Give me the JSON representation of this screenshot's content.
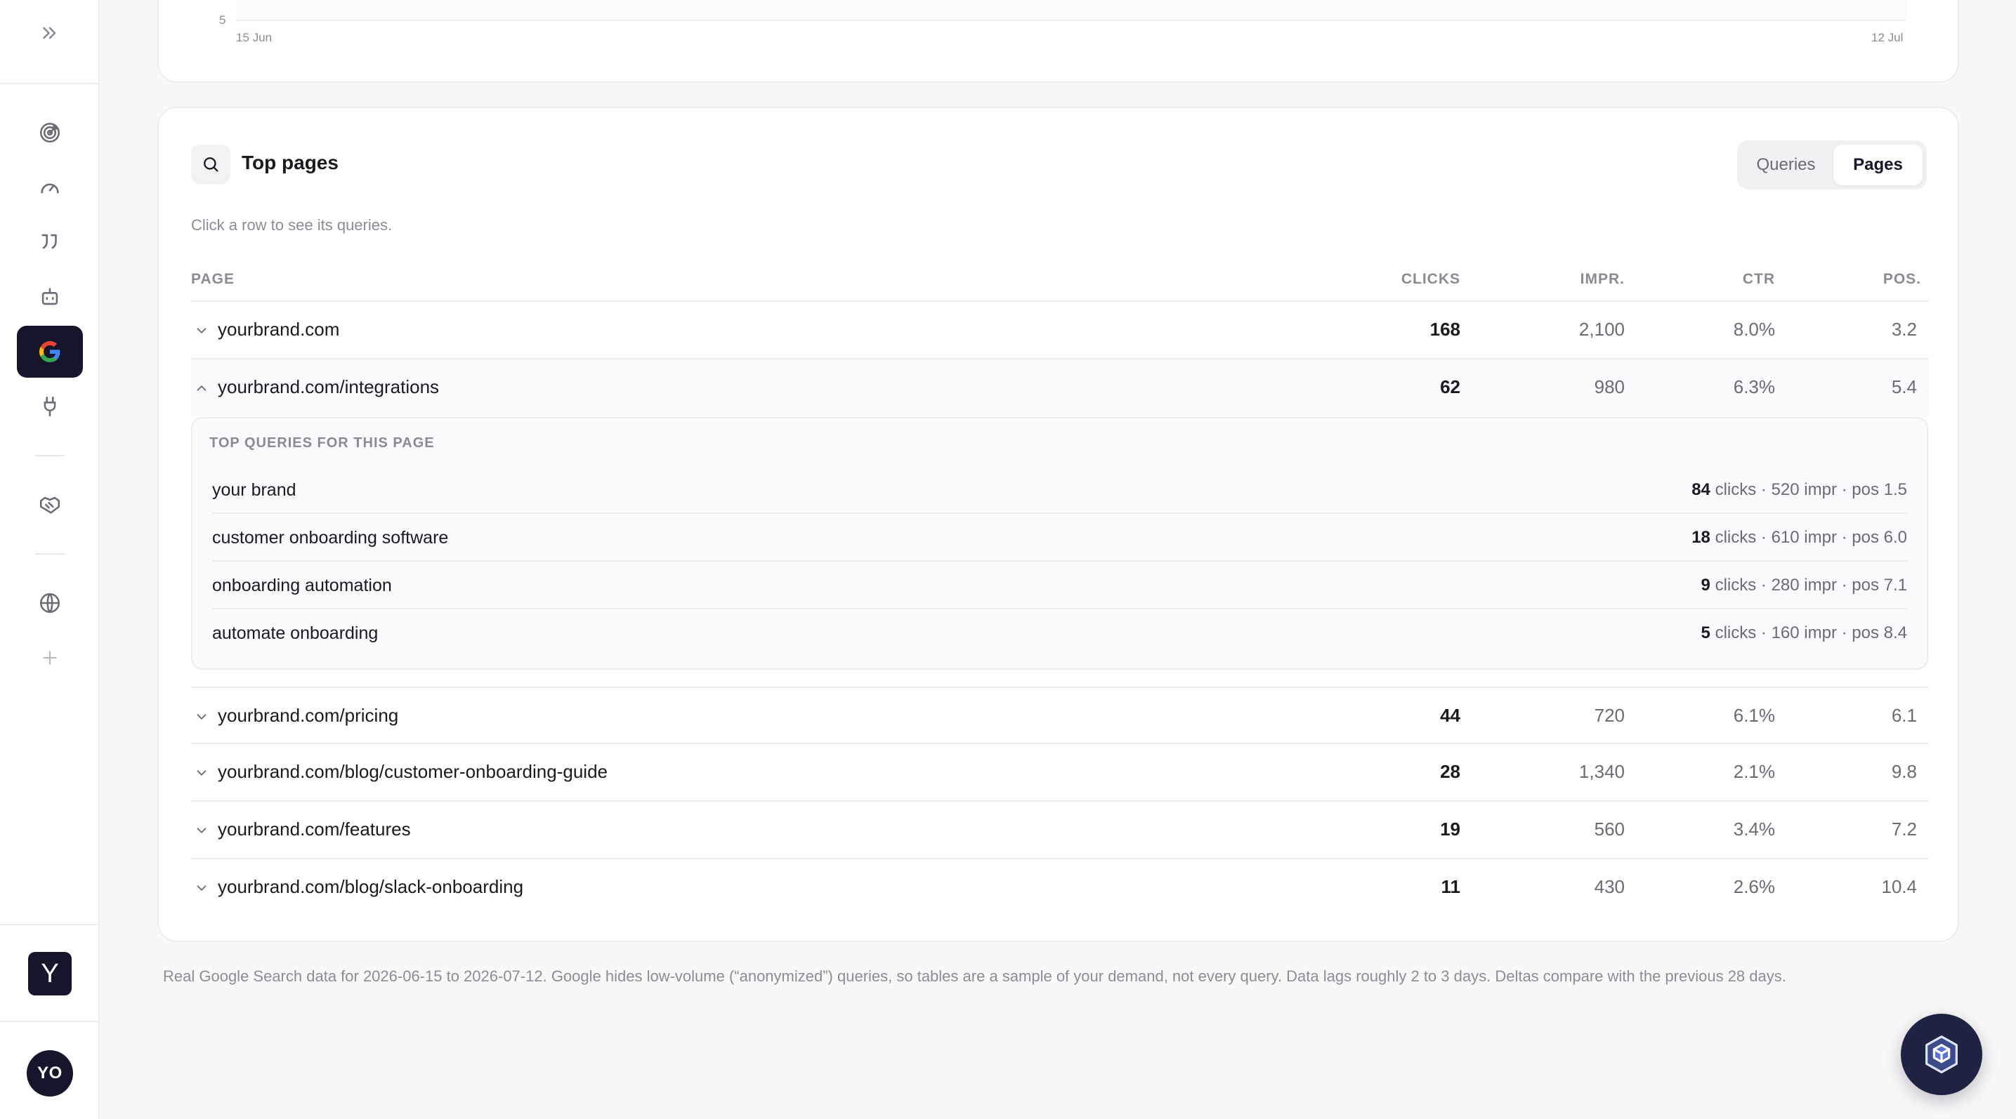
{
  "sidebar": {
    "items": [
      {
        "icon": "chevrons-right-icon"
      },
      {
        "icon": "target-icon"
      },
      {
        "icon": "gauge-icon"
      },
      {
        "icon": "quote-icon"
      },
      {
        "icon": "robot-icon"
      },
      {
        "icon": "google-icon",
        "active": true
      },
      {
        "icon": "plug-icon"
      },
      {
        "icon": "handshake-icon"
      },
      {
        "icon": "globe-icon"
      },
      {
        "icon": "plus-icon"
      }
    ],
    "logo_letter": "Y",
    "avatar_initials": "YO"
  },
  "chart": {
    "y_tick": "5",
    "x_start": "15 Jun",
    "x_end": "12 Jul"
  },
  "top_pages": {
    "title": "Top pages",
    "tabs": [
      "Queries",
      "Pages"
    ],
    "active_tab": "Pages",
    "hint": "Click a row to see its queries.",
    "columns": {
      "page": "PAGE",
      "clicks": "CLICKS",
      "impr": "IMPR.",
      "ctr": "CTR",
      "pos": "POS."
    },
    "rows": [
      {
        "page": "yourbrand.com",
        "clicks": "168",
        "impr": "2,100",
        "ctr": "8.0%",
        "pos": "3.2"
      },
      {
        "page": "yourbrand.com/integrations",
        "clicks": "62",
        "impr": "980",
        "ctr": "6.3%",
        "pos": "5.4",
        "expanded": true
      },
      {
        "page": "yourbrand.com/pricing",
        "clicks": "44",
        "impr": "720",
        "ctr": "6.1%",
        "pos": "6.1"
      },
      {
        "page": "yourbrand.com/blog/customer-onboarding-guide",
        "clicks": "28",
        "impr": "1,340",
        "ctr": "2.1%",
        "pos": "9.8"
      },
      {
        "page": "yourbrand.com/features",
        "clicks": "19",
        "impr": "560",
        "ctr": "3.4%",
        "pos": "7.2"
      },
      {
        "page": "yourbrand.com/blog/slack-onboarding",
        "clicks": "11",
        "impr": "430",
        "ctr": "2.6%",
        "pos": "10.4"
      }
    ],
    "detail": {
      "label": "TOP QUERIES FOR THIS PAGE",
      "queries": [
        {
          "query": "your brand",
          "clicks": "84",
          "rest": " clicks · 520 impr · pos 1.5"
        },
        {
          "query": "customer onboarding software",
          "clicks": "18",
          "rest": " clicks · 610 impr · pos 6.0"
        },
        {
          "query": "onboarding automation",
          "clicks": "9",
          "rest": " clicks · 280 impr · pos 7.1"
        },
        {
          "query": "automate onboarding",
          "clicks": "5",
          "rest": " clicks · 160 impr · pos 8.4"
        }
      ]
    }
  },
  "footnote": "Real Google Search data for 2026-06-15 to 2026-07-12. Google hides low-volume (“anonymized”) queries, so tables are a sample of your demand, not every query. Data lags roughly 2 to 3 days. Deltas compare with the previous 28 days.",
  "fab": {
    "icon": "cube-assistant-icon"
  }
}
